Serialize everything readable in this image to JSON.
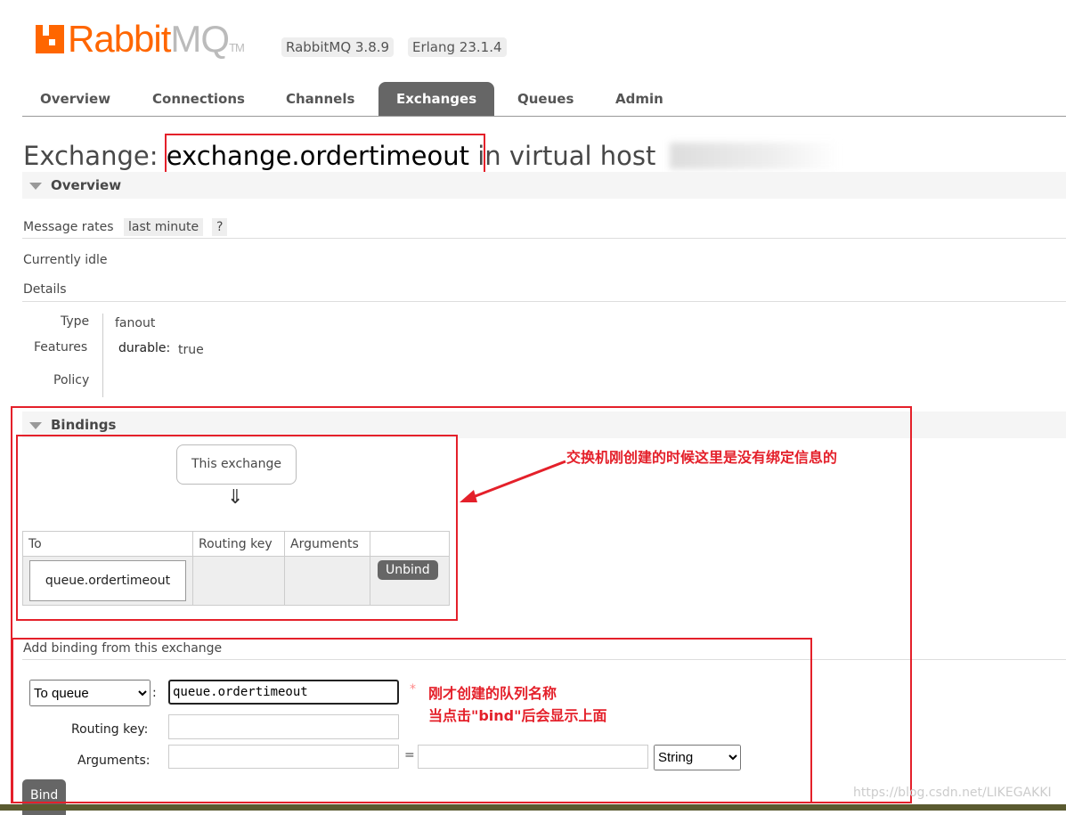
{
  "header": {
    "logo_text_a": "Rabbit",
    "logo_text_b": "MQ",
    "logo_tm": "TM",
    "version": "RabbitMQ 3.8.9",
    "erlang": "Erlang 23.1.4"
  },
  "tabs": [
    {
      "label": "Overview"
    },
    {
      "label": "Connections"
    },
    {
      "label": "Channels"
    },
    {
      "label": "Exchanges",
      "selected": true
    },
    {
      "label": "Queues"
    },
    {
      "label": "Admin"
    }
  ],
  "title": {
    "prefix": "Exchange:",
    "name": "exchange.ordertimeout",
    "suffix": "in virtual host"
  },
  "overview": {
    "heading": "Overview",
    "message_rates": "Message rates",
    "rate_range": "last minute",
    "help": "?",
    "idle": "Currently idle",
    "details": "Details",
    "type_label": "Type",
    "type": "fanout",
    "features_label": "Features",
    "durable_label": "durable:",
    "durable": "true",
    "policy_label": "Policy"
  },
  "bindings": {
    "heading": "Bindings",
    "this_exchange": "This exchange",
    "arrow": "⇓",
    "columns": [
      "To",
      "Routing key",
      "Arguments",
      ""
    ],
    "rows": [
      {
        "to": "queue.ordertimeout",
        "routing_key": "",
        "arguments": "",
        "action": "Unbind"
      }
    ]
  },
  "add_binding": {
    "heading": "Add binding from this exchange",
    "dest_type": "To queue",
    "dest_value": "queue.ordertimeout",
    "required": "*",
    "routing_key_label": "Routing key:",
    "routing_key": "",
    "arguments_label": "Arguments:",
    "arg_key": "",
    "arg_value": "",
    "arg_type": "String",
    "eq": "=",
    "submit": "Bind"
  },
  "annotations": {
    "bindings_note": "交换机刚创建的时候这里是没有绑定信息的",
    "queue_note_1": "刚才创建的队列名称",
    "queue_note_2": "当点击\"bind\"后会显示上面"
  },
  "watermark": "https://blog.csdn.net/LIKEGAKKI",
  "colors": {
    "brand": "#ff6600",
    "annotation": "#e4202a",
    "tab_selected": "#666666"
  }
}
